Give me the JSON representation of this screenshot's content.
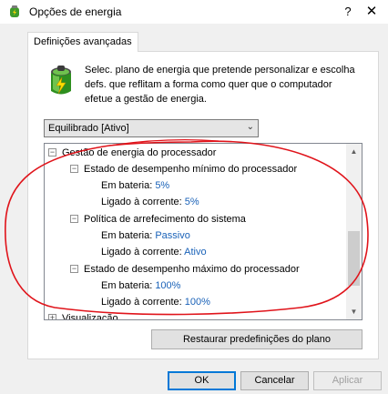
{
  "window": {
    "title": "Opções de energia",
    "help_glyph": "?",
    "close_glyph": "✕"
  },
  "tab": {
    "label": "Definições avançadas"
  },
  "intro": {
    "text": "Selec. plano de energia que pretende personalizar e escolha defs. que reflitam a forma como quer que o computador efetue a gestão de energia."
  },
  "plan_select": {
    "value": "Equilibrado [Ativo]"
  },
  "tree": {
    "group_label": "Gestão de energia do processador",
    "min_state": {
      "label": "Estado de desempenho mínimo do processador",
      "battery_label": "Em bateria:",
      "battery_value": "5%",
      "plugged_label": "Ligado à corrente:",
      "plugged_value": "5%"
    },
    "cooling": {
      "label": "Política de arrefecimento do sistema",
      "battery_label": "Em bateria:",
      "battery_value": "Passivo",
      "plugged_label": "Ligado à corrente:",
      "plugged_value": "Ativo"
    },
    "max_state": {
      "label": "Estado de desempenho máximo do processador",
      "battery_label": "Em bateria:",
      "battery_value": "100%",
      "plugged_label": "Ligado à corrente:",
      "plugged_value": "100%"
    },
    "next_group_label": "Visualização"
  },
  "buttons": {
    "restore": "Restaurar predefinições do plano",
    "ok": "OK",
    "cancel": "Cancelar",
    "apply": "Aplicar"
  },
  "colors": {
    "value_text": "#1a62b8",
    "annotation": "#e0141b"
  }
}
